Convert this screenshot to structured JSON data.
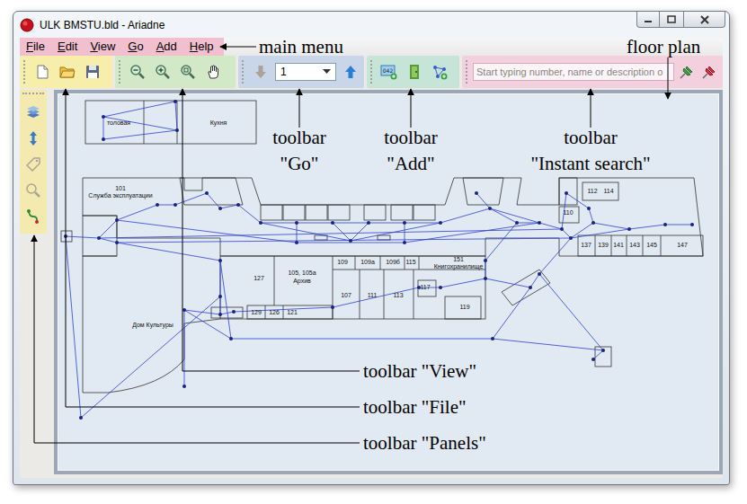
{
  "window": {
    "title": "ULK BMSTU.bld - Ariadne"
  },
  "menu": [
    "File",
    "Edit",
    "View",
    "Go",
    "Add",
    "Help"
  ],
  "go": {
    "floor": "1",
    "down_disabled": true,
    "up_disabled": false
  },
  "add": {
    "number_badge": "042"
  },
  "search": {
    "placeholder": "Start typing number, name or description o"
  },
  "panels": [
    {
      "disabled": false
    },
    {
      "disabled": false
    },
    {
      "disabled": true
    },
    {
      "disabled": true
    },
    {
      "disabled": false
    }
  ],
  "plan": {
    "labels": [
      "Кухня",
      "толовая",
      "101",
      "Служба эксплуатации",
      "112",
      "114",
      "110",
      "137",
      "139",
      "141",
      "143",
      "145",
      "147",
      "127",
      "105, 105а",
      "Архив",
      "109",
      "109а",
      "109б",
      "115",
      "151",
      "Книгохранилище",
      "117",
      "107",
      "111",
      "113",
      "119",
      "129",
      "126",
      "121",
      "Дом Культуры"
    ]
  },
  "annotations": [
    {
      "lines": [
        "main menu"
      ]
    },
    {
      "lines": [
        "floor plan"
      ]
    },
    {
      "lines": [
        "toolbar",
        "\"Go\""
      ]
    },
    {
      "lines": [
        "toolbar",
        "\"Add\""
      ]
    },
    {
      "lines": [
        "toolbar",
        "\"Instant search\""
      ]
    },
    {
      "lines": [
        "toolbar \"View\""
      ]
    },
    {
      "lines": [
        "toolbar \"File\""
      ]
    },
    {
      "lines": [
        "toolbar \"Panels\""
      ]
    }
  ]
}
